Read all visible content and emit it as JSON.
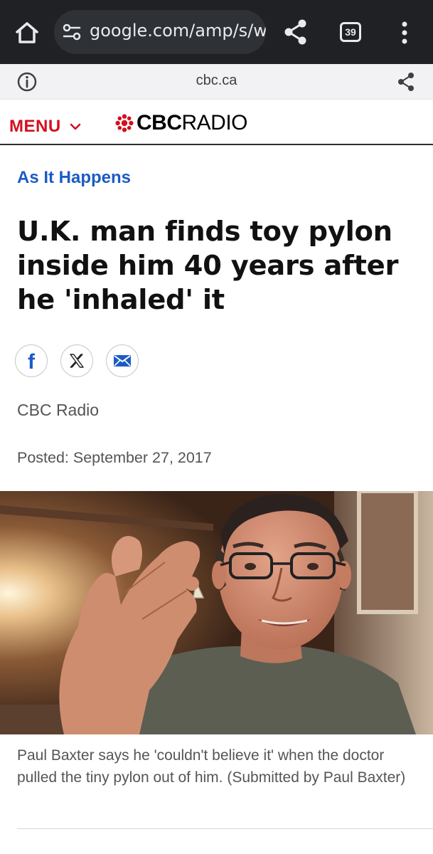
{
  "browser": {
    "url": "google.com/amp/s/www.cbc.ca",
    "tab_count": "39"
  },
  "amp_bar": {
    "domain": "cbc.ca"
  },
  "header": {
    "menu_label": "MENU",
    "logo_bold": "CBC",
    "logo_light": "RADIO",
    "brand_color": "#d3101f"
  },
  "article": {
    "section": "As It Happens",
    "headline": "U.K. man finds toy pylon inside him 40 years after he 'inhaled' it",
    "share_icons": [
      "facebook-icon",
      "x-icon",
      "email-icon"
    ],
    "byline": "CBC Radio",
    "posted": "Posted: September 27, 2017",
    "photo_caption": "Paul Baxter says he 'couldn't believe it' when the doctor pulled the tiny pylon out of him. (Submitted by Paul Baxter)"
  },
  "colors": {
    "browser_bar": "#1f2124",
    "link_blue": "#1c5bc4"
  }
}
